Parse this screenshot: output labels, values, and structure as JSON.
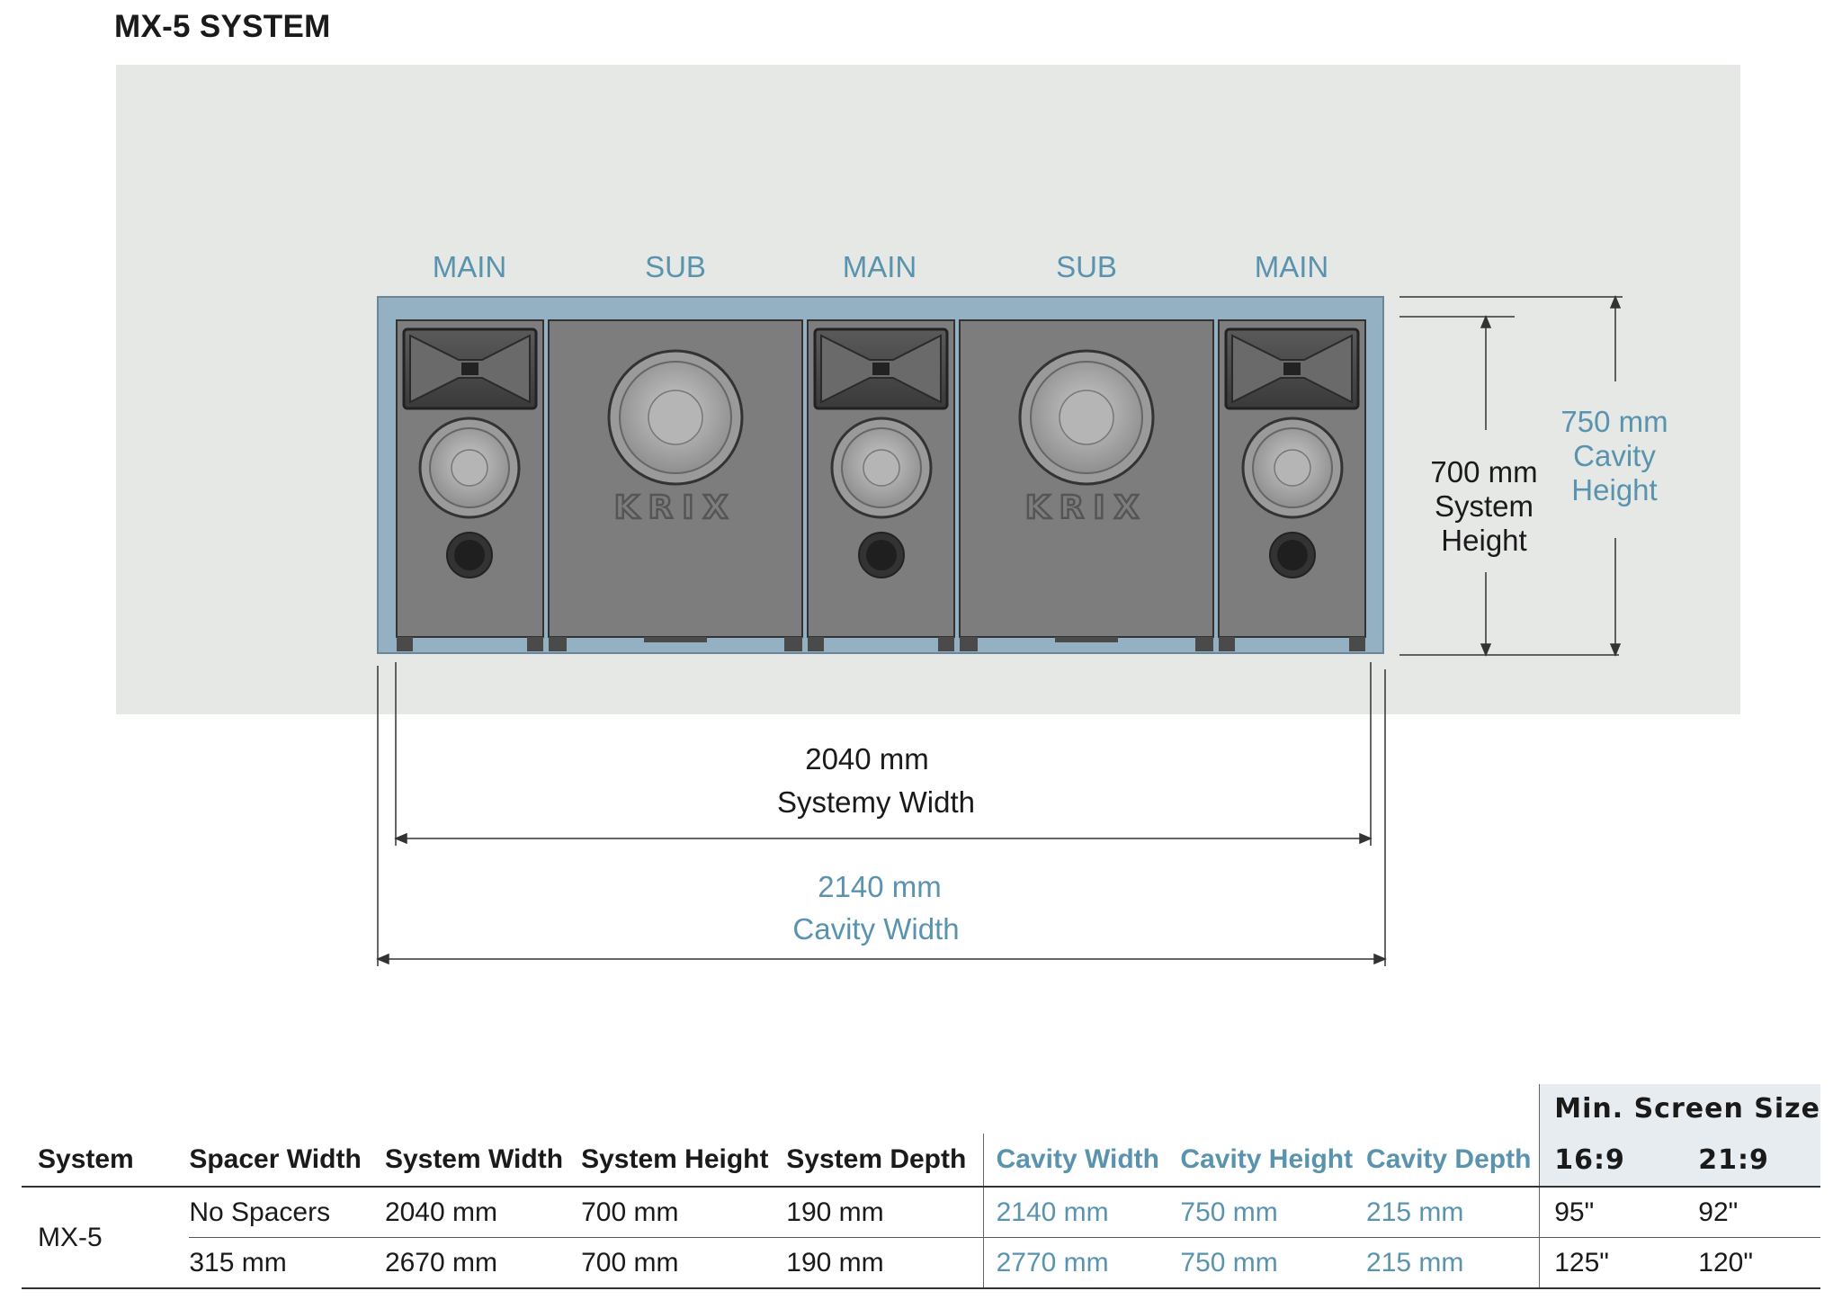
{
  "title": "MX-5 SYSTEM",
  "speaker_labels": [
    "MAIN",
    "SUB",
    "MAIN",
    "SUB",
    "MAIN"
  ],
  "logo_text": "KRIX",
  "dimensions": {
    "system_height": [
      "700 mm",
      "System",
      "Height"
    ],
    "cavity_height": [
      "750 mm",
      "Cavity",
      "Height"
    ],
    "system_width": [
      "2040 mm",
      "Systemy Width"
    ],
    "cavity_width": [
      "2140 mm",
      "Cavity Width"
    ]
  },
  "colors": {
    "accent_blue": "#5a93ad",
    "cavity_fill": "#93b1c3",
    "wall": "#e6e8e6",
    "speaker": "#7d7d7d"
  },
  "table": {
    "min_screen_size": "Min. Screen Size",
    "headers": [
      "System",
      "Spacer Width",
      "System Width",
      "System Height",
      "System Depth",
      "Cavity Width",
      "Cavity Height",
      "Cavity Depth",
      "16:9",
      "21:9"
    ],
    "system_name": "MX-5",
    "rows": [
      [
        "No Spacers",
        "2040 mm",
        "700 mm",
        "190 mm",
        "2140 mm",
        "750 mm",
        "215 mm",
        "95\"",
        "92\""
      ],
      [
        "315 mm",
        "2670 mm",
        "700 mm",
        "190 mm",
        "2770 mm",
        "750 mm",
        "215 mm",
        "125\"",
        "120\""
      ]
    ]
  }
}
